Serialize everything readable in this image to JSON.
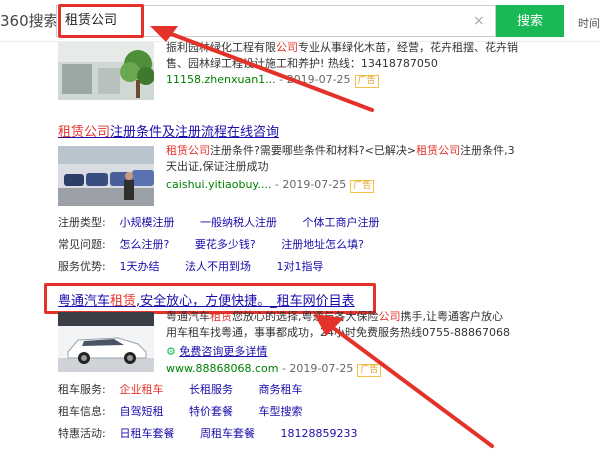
{
  "header": {
    "logo": "360搜索",
    "query": "租赁公司",
    "clear_icon": "×",
    "search_button": "搜索",
    "time_link": "时间"
  },
  "result1": {
    "desc_line1_a": "振利园林绿化工程有限",
    "desc_line1_b": "公司",
    "desc_line1_c": "专业从事绿化木苗，经营，花卉租摆、花卉销",
    "desc_line2": "售、园林绿工程设计施工和养护! 热线：13418787050",
    "url": "11158.zhenxuan1...",
    "date": "- 2019-07-25",
    "ad": "广告"
  },
  "result2": {
    "title_hl": "租赁公司",
    "title_rest": "注册条件及注册流程在线咨询",
    "desc_a": "租赁公司",
    "desc_b": "注册条件?需要哪些条件和材料?<已解决>",
    "desc_c": "租赁公司",
    "desc_d": "注册条件,3",
    "desc_line2": "天出证,保证注册成功",
    "url": "caishui.yitiaobuy....",
    "date": "- 2019-07-25",
    "ad": "广告",
    "rows": [
      {
        "key": "注册类型:",
        "values": [
          "小规模注册",
          "一般纳税人注册",
          "个体工商户注册"
        ]
      },
      {
        "key": "常见问题:",
        "values": [
          "怎么注册?",
          "要花多少钱?",
          "注册地址怎么填?"
        ]
      },
      {
        "key": "服务优势:",
        "values": [
          "1天办结",
          "法人不用到场",
          "1对1指导"
        ]
      }
    ]
  },
  "result3": {
    "title_a": "粤通汽车",
    "title_hl": "租赁",
    "title_b": ",安全放心，方便快捷。_租车网价目表",
    "desc_a": "粤通汽车",
    "desc_hl1": "租赁",
    "desc_b": "您放心的选择,粤通与各大保险",
    "desc_hl2": "公司",
    "desc_c": "携手,让粤通客户放心",
    "desc_line2": "用车租车找粤通，事事都成功，24小时免费服务热线0755-88867068",
    "consult_link": "免费咨询更多详情",
    "url": "www.88868068.com",
    "date": "- 2019-07-25",
    "ad": "广告",
    "rows": [
      {
        "key": "租车服务:",
        "values": [
          "企业租车",
          "长租服务",
          "商务租车"
        ]
      },
      {
        "key": "租车信息:",
        "values": [
          "自驾短租",
          "特价套餐",
          "车型搜索"
        ]
      },
      {
        "key": "特惠活动:",
        "values": [
          "日租车套餐",
          "周租车套餐",
          "18128859233"
        ]
      }
    ]
  },
  "colors": {
    "accent_green": "#19b955",
    "highlight_red": "#e4322b",
    "link_blue": "#1a0dab",
    "url_green": "#008000"
  }
}
